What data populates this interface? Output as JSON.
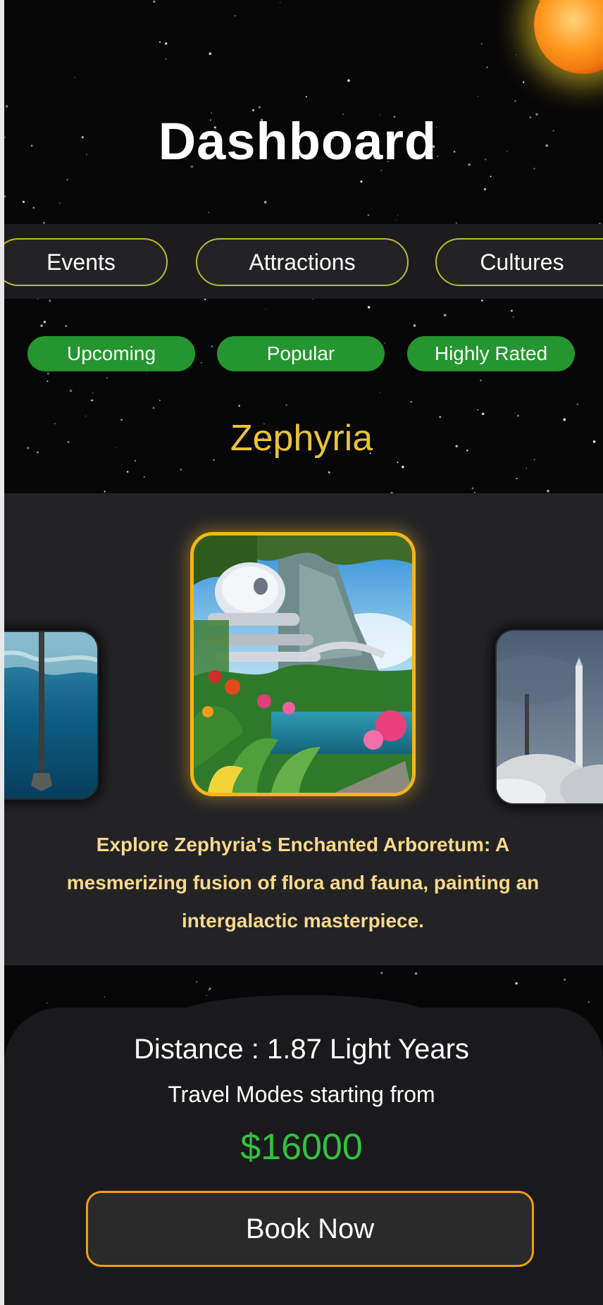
{
  "header": {
    "title": "Dashboard"
  },
  "categories": [
    "Events",
    "Attractions",
    "Cultures"
  ],
  "filters": [
    "Upcoming",
    "Popular",
    "Highly Rated"
  ],
  "planet": {
    "name": "Zephyria"
  },
  "carousel": {
    "description": "Explore Zephyria's Enchanted Arboretum: A mesmerizing fusion of flora and fauna, painting an intergalactic masterpiece.",
    "items": [
      {
        "subject": "ocean-pier"
      },
      {
        "subject": "enchanted-arboretum"
      },
      {
        "subject": "rocket-launch"
      }
    ]
  },
  "info": {
    "distance": "Distance  : 1.87 Light Years",
    "travel_modes": "Travel Modes starting from",
    "price": "$16000",
    "book_label": "Book Now"
  },
  "colors": {
    "background": "#070708",
    "tab_border": "#b8bc2e",
    "filter_bg": "#259530",
    "planet_name": "#e8c43a",
    "featured_border": "#f5b518",
    "description": "#f8d98a",
    "price": "#33c23f",
    "button_border": "#f39c12"
  }
}
